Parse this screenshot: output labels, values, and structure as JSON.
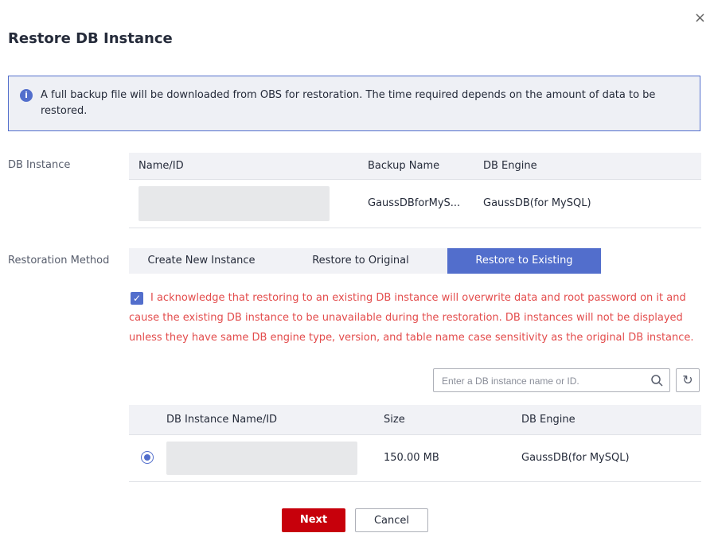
{
  "dialog": {
    "title": "Restore DB Instance",
    "close_label": "×",
    "info_text": "A full backup file will be downloaded from OBS for restoration. The time required depends on the amount of data to be restored."
  },
  "db_instance": {
    "label": "DB Instance",
    "columns": [
      "Name/ID",
      "Backup Name",
      "DB Engine"
    ],
    "row": {
      "name_id": "",
      "backup_name": "GaussDBforMyS...",
      "db_engine": "GaussDB(for MySQL)"
    }
  },
  "restoration": {
    "label": "Restoration Method",
    "options": [
      "Create New Instance",
      "Restore to Original",
      "Restore to Existing"
    ],
    "selected": "Restore to Existing",
    "ack_checked": true,
    "ack_text": "I acknowledge that restoring to an existing DB instance will overwrite data and root password on it and cause the existing DB instance to be unavailable during the restoration. DB instances will not be displayed unless they have same DB engine type, version, and table name case sensitivity as the original DB instance."
  },
  "search": {
    "placeholder": "Enter a DB instance name or ID."
  },
  "target_table": {
    "columns": [
      "DB Instance Name/ID",
      "Size",
      "DB Engine"
    ],
    "rows": [
      {
        "name_id": "",
        "size": "150.00 MB",
        "db_engine": "GaussDB(for MySQL)",
        "selected": true
      }
    ]
  },
  "footer": {
    "next_label": "Next",
    "cancel_label": "Cancel"
  },
  "colors": {
    "accent": "#526ecc",
    "danger_text": "#e34c4c",
    "primary_button": "#c7000b"
  }
}
